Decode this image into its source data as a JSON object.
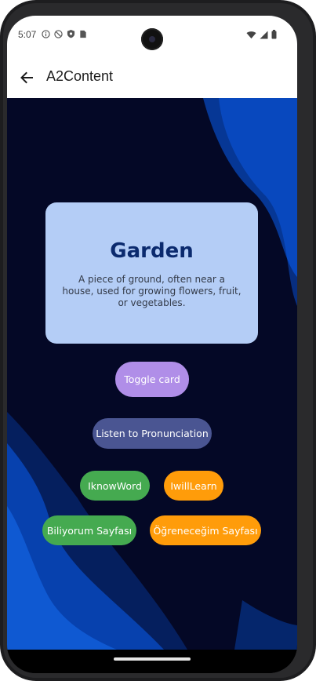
{
  "status_bar": {
    "time": "5:07",
    "left_icons": [
      "info-icon",
      "block-icon",
      "shield-icon",
      "sim-icon"
    ],
    "right_icons": [
      "wifi-icon",
      "signal-icon",
      "battery-icon"
    ]
  },
  "app_bar": {
    "title": "A2Content",
    "back_icon": "arrow-back-icon"
  },
  "card": {
    "word": "Garden",
    "definition": "A piece of ground, often near a house, used for growing flowers, fruit, or vegetables."
  },
  "buttons": {
    "toggle_card": "Toggle card",
    "listen": "Listen to Pronunciation",
    "iknow": "IknowWord",
    "iwill": "IwillLearn",
    "biliyorum": "Biliyorum Sayfası",
    "ogrenecegim": "Öğreneceğim Sayfası"
  },
  "colors": {
    "background": "#040826",
    "wave_blue": "#0a5ef0",
    "card": "#b4cdf6",
    "card_title": "#0b2a6e",
    "toggle": "#b08ee8",
    "listen": "#4a5592",
    "green": "#45aa50",
    "orange": "#ff9c0a"
  }
}
